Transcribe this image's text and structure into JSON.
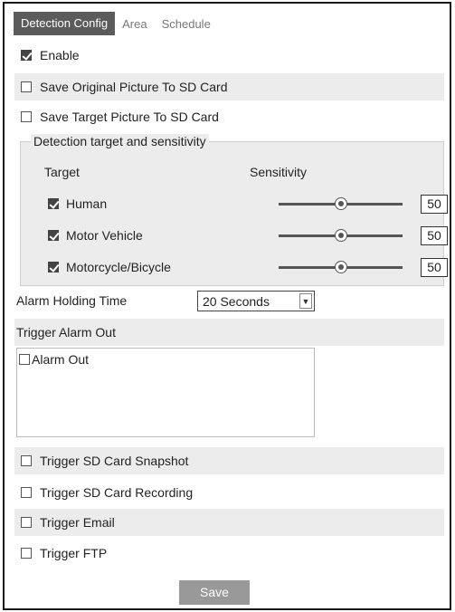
{
  "tabs": [
    {
      "label": "Detection Config",
      "active": true
    },
    {
      "label": "Area",
      "active": false
    },
    {
      "label": "Schedule",
      "active": false
    }
  ],
  "options": {
    "enable": {
      "label": "Enable",
      "checked": true
    },
    "save_original": {
      "label": "Save Original Picture To SD Card",
      "checked": false
    },
    "save_target": {
      "label": "Save Target Picture To SD Card",
      "checked": false
    }
  },
  "detection": {
    "title": "Detection target and sensitivity",
    "target_header": "Target",
    "sensitivity_header": "Sensitivity",
    "targets": [
      {
        "label": "Human",
        "checked": true,
        "sensitivity": "50",
        "level": 0.5
      },
      {
        "label": "Motor Vehicle",
        "checked": true,
        "sensitivity": "50",
        "level": 0.5
      },
      {
        "label": "Motorcycle/Bicycle",
        "checked": true,
        "sensitivity": "50",
        "level": 0.5
      }
    ]
  },
  "alarm_holding": {
    "label": "Alarm Holding Time",
    "value": "20 Seconds"
  },
  "trigger_alarm_out": {
    "label": "Trigger Alarm Out",
    "items": [
      {
        "label": "Alarm Out",
        "checked": false
      }
    ]
  },
  "triggers": {
    "sd_snapshot": {
      "label": "Trigger SD Card Snapshot",
      "checked": false
    },
    "sd_recording": {
      "label": "Trigger SD Card Recording",
      "checked": false
    },
    "email": {
      "label": "Trigger Email",
      "checked": false
    },
    "ftp": {
      "label": "Trigger FTP",
      "checked": false
    }
  },
  "save_label": "Save",
  "colors": {
    "tab_active": "#5b5b5b",
    "row_shade": "#ececec",
    "button": "#999999"
  }
}
